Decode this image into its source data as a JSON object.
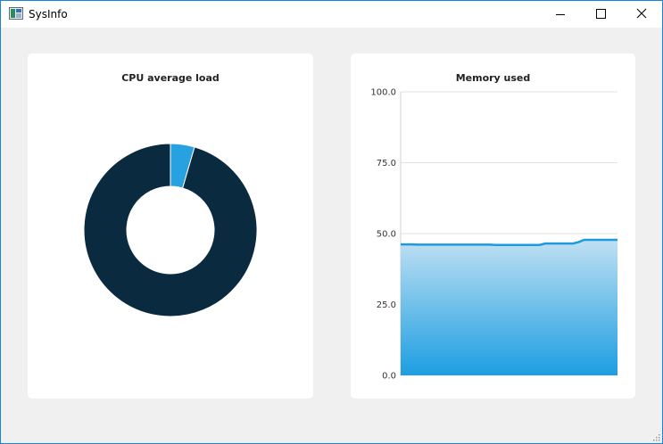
{
  "window": {
    "title": "SysInfo",
    "minimize_icon": "minimize-icon",
    "maximize_icon": "maximize-icon",
    "close_icon": "close-icon"
  },
  "colors": {
    "cpu_load": "#27a1e0",
    "cpu_free": "#0a2a40",
    "memory_line": "#1b9ae0",
    "memory_fill_top": "#bfe0f2",
    "memory_fill_bottom": "#1d9ee2",
    "grid": "#e2e2e2"
  },
  "chart_data": [
    {
      "type": "pie",
      "title": "CPU average load",
      "donut": true,
      "slices": [
        {
          "label": "",
          "value": 4.5
        },
        {
          "label": "",
          "value": 95.5
        }
      ]
    },
    {
      "type": "area",
      "title": "Memory used",
      "xlabel": "",
      "ylabel": "",
      "ylim": [
        0,
        100
      ],
      "yticks": [
        "0.0",
        "25.0",
        "50.0",
        "75.0",
        "100.0"
      ],
      "grid": true,
      "x": [
        0,
        1,
        2,
        3,
        4,
        5,
        6,
        7,
        8,
        9,
        10,
        11,
        12,
        13,
        14,
        15,
        16,
        17,
        18,
        19,
        20,
        21,
        22,
        23,
        24,
        25,
        26,
        27,
        28,
        29,
        30,
        31,
        32,
        33,
        34,
        35,
        36,
        37,
        38,
        39
      ],
      "values": [
        46.2,
        46.2,
        46.2,
        46.1,
        46.1,
        46.1,
        46.1,
        46.1,
        46.1,
        46.1,
        46.1,
        46.1,
        46.1,
        46.1,
        46.1,
        46.1,
        46.1,
        46.0,
        46.0,
        46.0,
        46.0,
        46.0,
        46.0,
        46.0,
        46.0,
        46.0,
        46.5,
        46.5,
        46.5,
        46.5,
        46.5,
        46.5,
        47.0,
        47.8,
        47.8,
        47.8,
        47.8,
        47.8,
        47.8,
        47.8
      ]
    }
  ]
}
